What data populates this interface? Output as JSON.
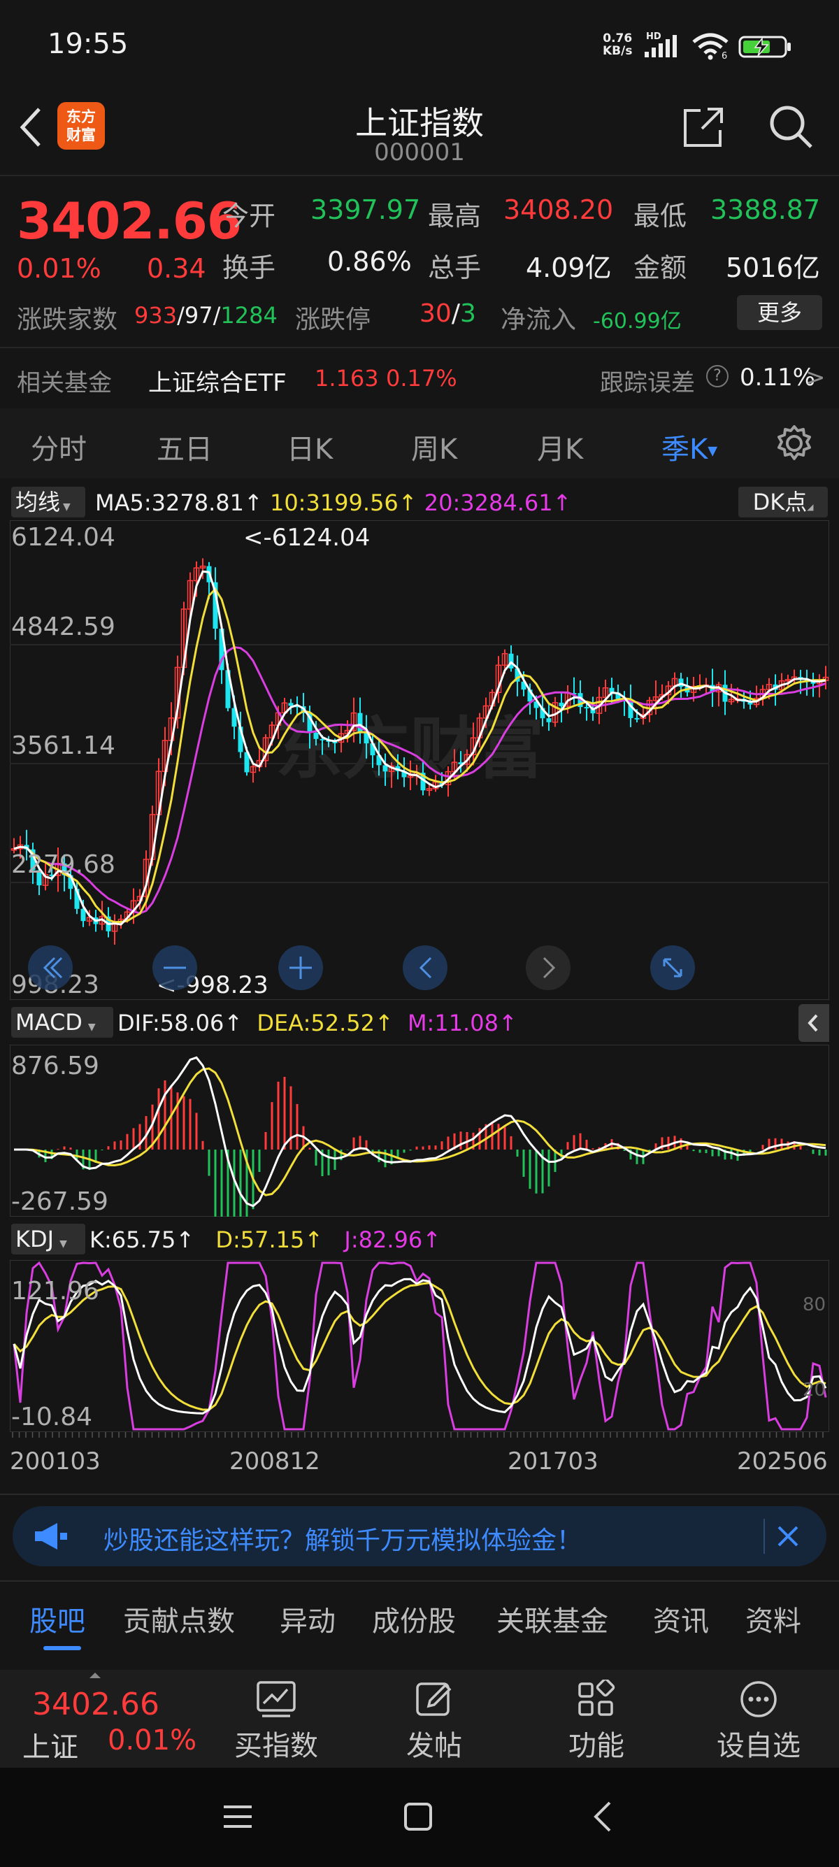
{
  "status_bar": {
    "time": "19:55",
    "net_speed": "0.76",
    "net_unit": "KB/s",
    "hd": "HD",
    "sim": "6",
    "battery": "⚡"
  },
  "header": {
    "title": "上证指数",
    "code": "000001",
    "logo_text_top": "东方",
    "logo_text_bottom": "财富"
  },
  "quote": {
    "price": "3402.66",
    "pct": "0.01%",
    "change": "0.34",
    "open_label": "今开",
    "open": "3397.97",
    "high_label": "最高",
    "high": "3408.20",
    "low_label": "最低",
    "low": "3388.87",
    "turnover_label": "换手",
    "turnover": "0.86%",
    "volume_label": "总手",
    "volume": "4.09亿",
    "amount_label": "金额",
    "amount": "5016亿",
    "breadth_label": "涨跌家数",
    "up": "933",
    "flat": "97",
    "down": "1284",
    "slash": "/",
    "limit_label": "涨跌停",
    "limit_up": "30",
    "limit_down": "3",
    "netflow_label": "净流入",
    "netflow": "-60.99亿",
    "more_button": "更多"
  },
  "fund": {
    "label": "相关基金",
    "name": "上证综合ETF",
    "price": "1.163",
    "pct": "0.17%",
    "err_label": "跟踪误差",
    "help": "?",
    "err_value": "0.11%",
    "arrow": ">"
  },
  "tabs": [
    {
      "label": "分时"
    },
    {
      "label": "五日"
    },
    {
      "label": "日K"
    },
    {
      "label": "周K"
    },
    {
      "label": "月K"
    },
    {
      "label": "季K"
    }
  ],
  "active_tab_caret": "▼",
  "ma_bar": {
    "selector": "均线",
    "ma5": "MA5:3278.81",
    "ma10": "10:3199.56",
    "ma20": "20:3284.61",
    "arrow": "↑",
    "dk_button": "DK点"
  },
  "chart": {
    "y_labels": [
      "6124.04",
      "4842.59",
      "3561.14",
      "2279.68",
      "998.23"
    ],
    "max_annotation": "<-6124.04",
    "min_annotation": "<-998.23",
    "watermark": "东方财富",
    "colors": {
      "up": "#ff3b3b",
      "down": "#1ee6f0",
      "ma5": "#ffffff",
      "ma10": "#f2df3a",
      "ma20": "#d93ee0"
    }
  },
  "macd_bar": {
    "selector": "MACD",
    "dif": "DIF:58.06",
    "dea": "DEA:52.52",
    "m": "M:11.08",
    "arrow": "↑",
    "y_top": "876.59",
    "y_bottom": "-267.59"
  },
  "kdj_bar": {
    "selector": "KDJ",
    "k": "K:65.75",
    "d": "D:57.15",
    "j": "J:82.96",
    "arrow": "↑",
    "y_top": "121.96",
    "y_bottom": "-10.84",
    "level_80": "80",
    "level_20": "20"
  },
  "x_axis": [
    "200103",
    "200812",
    "201703",
    "202506"
  ],
  "banner": {
    "text": "炒股还能这样玩？解锁千万元模拟体验金！"
  },
  "sub_tabs": [
    {
      "label": "股吧"
    },
    {
      "label": "贡献点数"
    },
    {
      "label": "异动"
    },
    {
      "label": "成份股"
    },
    {
      "label": "关联基金"
    },
    {
      "label": "资讯"
    },
    {
      "label": "资料"
    }
  ],
  "bottom_bar": {
    "mini_price": "3402.66",
    "mini_name": "上证",
    "mini_pct": "0.01%",
    "buy_label": "买指数",
    "post_label": "发帖",
    "func_label": "功能",
    "watch_label": "设自选"
  }
}
